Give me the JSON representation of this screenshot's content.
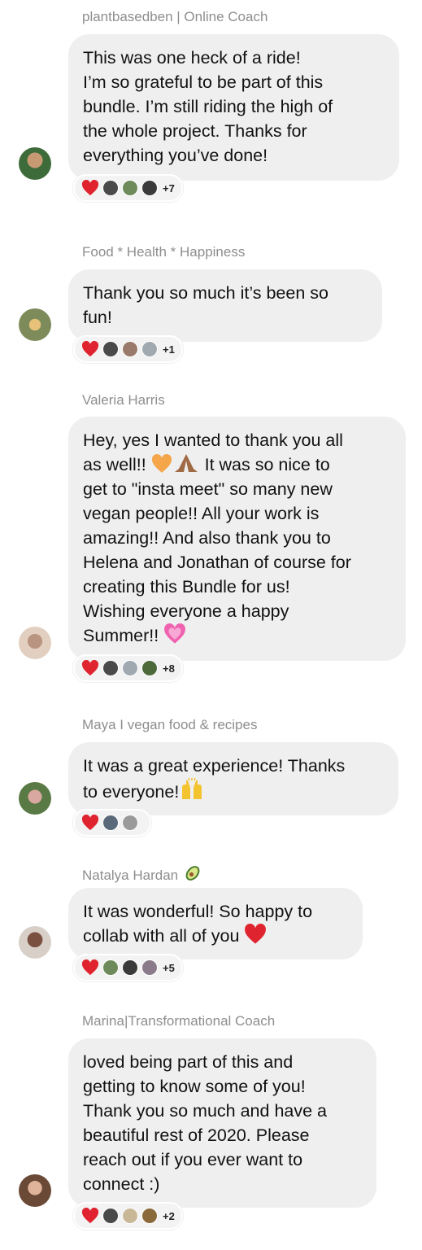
{
  "messages": [
    {
      "sender": "plantbasedben  | Online Coach",
      "lines": [
        "This was one heck of a ride!",
        "I’m so grateful  to be part of this",
        "bundle. I’m still riding the high of",
        "the whole project. Thanks for",
        "everything  you’ve done!"
      ],
      "reaction_count": "+7",
      "avatar_color": "#6b5a3e"
    },
    {
      "sender": "Food * Health * Happiness",
      "lines": [
        "Thank you so much it’s been so",
        "fun!"
      ],
      "reaction_count": "+1",
      "avatar_color": "#7d8a5a"
    },
    {
      "sender": "Valeria Harris",
      "lines": [
        "Hey, yes I wanted to thank you all",
        "as well!! ",
        " It was so nice to",
        "get to \"insta meet\" so many new",
        "vegan people!! All your work is",
        "amazing!! And also thank you to",
        "Helena and Jonathan of course for",
        "creating this Bundle for us!",
        "Wishing everyone a happy",
        "Summer!! "
      ],
      "reaction_count": "+8",
      "avatar_color": "#d6b6a0"
    },
    {
      "sender": "Maya I vegan food & recipes",
      "lines": [
        "It was a great experience! Thanks",
        "to everyone!"
      ],
      "reaction_count": "",
      "avatar_color": "#6d8a55"
    },
    {
      "sender": "Natalya Hardan",
      "lines": [
        "It was wonderful! So happy to",
        "collab with all of you "
      ],
      "reaction_count": "+5",
      "avatar_color": "#a88a70"
    },
    {
      "sender": "Marina|Transformational Coach",
      "lines": [
        "loved being part of this and",
        "getting to know some of you!",
        "Thank you so much and have a",
        "beautiful rest of 2020. Please",
        "reach out if you ever want to",
        "connect :)"
      ],
      "reaction_count": "+2",
      "avatar_color": "#7a5e48"
    }
  ],
  "icons": {
    "reaction": "red-heart-icon",
    "orange_heart": "orange-heart-icon",
    "praying_hands": "folded-hands-icon",
    "pink_heart": "sparkling-heart-icon",
    "raised_hands": "raising-hands-icon",
    "avocado": "avocado-icon"
  },
  "colors": {
    "bubble": "#efefef",
    "sender_text": "#8e8e8e",
    "heart": "#e0242f"
  }
}
